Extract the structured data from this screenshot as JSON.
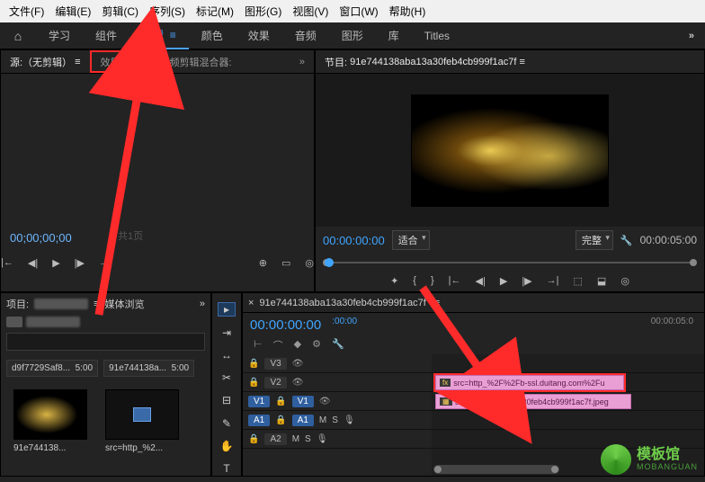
{
  "menu": [
    "文件(F)",
    "编辑(E)",
    "剪辑(C)",
    "序列(S)",
    "标记(M)",
    "图形(G)",
    "视图(V)",
    "窗口(W)",
    "帮助(H)"
  ],
  "workspaces": [
    "学习",
    "组件",
    "编辑",
    "颜色",
    "效果",
    "音频",
    "图形",
    "库",
    "Titles"
  ],
  "active_ws": 2,
  "source": {
    "tabs": [
      "源:（无剪辑）",
      "效果控件",
      "音频剪辑混合器:"
    ],
    "tc": "00;00;00;00",
    "pages": "共1页"
  },
  "program": {
    "title_prefix": "节目:",
    "clip": "91e744138aba13a30feb4cb999f1ac7f",
    "tc": "00:00:00:00",
    "fit": "适合",
    "full": "完整",
    "dur": "00:00:05:00"
  },
  "project": {
    "label": "项目:",
    "tab2": "媒体浏览",
    "search_ph": "",
    "assets": [
      {
        "name": "d9f7729Saf8...",
        "dur": "5:00"
      },
      {
        "name": "91e744138a...",
        "dur": "5:00"
      }
    ],
    "thumbs": [
      {
        "name": "91e744138..."
      },
      {
        "name": "src=http_%2..."
      }
    ]
  },
  "timeline": {
    "seq": "91e744138aba13a30feb4cb999f1ac7f",
    "tc": "00:00:00:00",
    "ruler_start": ":00:00",
    "ruler_end": "00:00:05:0",
    "tracks_v": [
      "V3",
      "V2",
      "V1"
    ],
    "tracks_a": [
      "A1",
      "A2"
    ],
    "mute": "M",
    "solo": "S",
    "clip_v2": "src=http_%2F%2Fb-ssl.duitang.com%2Fu",
    "clip_v1": "91e744138aba13a30feb4cb999f1ac7f.jpeg",
    "fx": "fx"
  },
  "watermark": {
    "name": "模板馆",
    "sub": "MOBANGUAN"
  }
}
